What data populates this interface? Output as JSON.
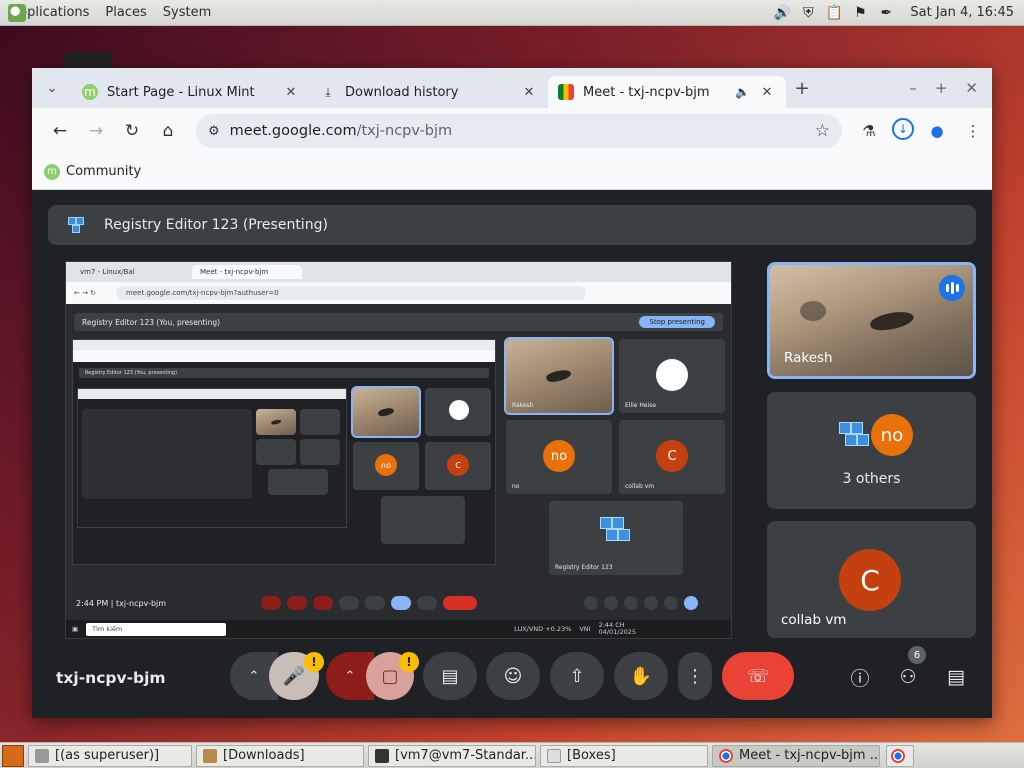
{
  "top_panel": {
    "menus": [
      "Applications",
      "Places",
      "System"
    ],
    "clock": "Sat Jan  4, 16:45",
    "tray_icons": [
      "volume-icon",
      "shield-icon",
      "clipboard-icon",
      "flag-icon",
      "pen-icon"
    ]
  },
  "browser": {
    "tabs": [
      {
        "title": "Start Page - Linux Mint",
        "icon": "mint-icon",
        "active": false
      },
      {
        "title": "Download history",
        "icon": "download-icon",
        "active": false
      },
      {
        "title": "Meet - txj-ncpv-bjm",
        "icon": "meet-icon",
        "active": true,
        "audio": true
      }
    ],
    "url_host": "meet.google.com",
    "url_path": "/txj-ncpv-bjm",
    "bookmarks": [
      "Community"
    ]
  },
  "meet": {
    "presenting_label": "Registry Editor 123 (Presenting)",
    "meeting_code": "txj-ncpv-bjm",
    "participants": [
      {
        "name": "Rakesh",
        "type": "video",
        "speaking": true
      },
      {
        "name": "3 others",
        "avatar_letters": "no"
      },
      {
        "name": "collab vm",
        "avatar_letter": "C",
        "avatar_color": "#c5400f"
      }
    ],
    "people_count": "6",
    "warning_glyph": "!",
    "shared_screen": {
      "tabs": [
        "vm7 - Linux/Bal",
        "Meet - txj-ncpv-bjm"
      ],
      "url": "meet.google.com/txj-ncpv-bjm?authuser=0",
      "presenting": "Registry Editor 123 (You, presenting)",
      "stop_label": "Stop presenting",
      "tiles": {
        "rakesh": "Rakesh",
        "ellie": "Ellie Heise",
        "no": "no",
        "no_avatar": "no",
        "collab": "collab vm",
        "collab_avatar": "C",
        "registry": "Registry Editor 123"
      },
      "nested_presenting": "Registry Editor 123 (You, presenting)",
      "time_code": "2:44 PM  |  txj-ncpv-bjm",
      "search": "Tìm kiếm",
      "tray_text": "LUX/VND  +0.23%",
      "lang": "VNI",
      "date": "2:44 CH\n04/01/2025"
    }
  },
  "taskbar": {
    "items": [
      {
        "label": "[(as superuser)]",
        "active": false
      },
      {
        "label": "[Downloads]",
        "active": false
      },
      {
        "label": "[vm7@vm7-Standar...",
        "active": false
      },
      {
        "label": "[Boxes]",
        "active": false
      },
      {
        "label": "Meet - txj-ncpv-bjm ...",
        "active": true
      }
    ]
  },
  "colors": {
    "meet_bg": "#202124",
    "tile_bg": "#3c4043",
    "hangup_red": "#ea4335",
    "accent_blue": "#8ab4f8",
    "avatar_orange": "#e8710a",
    "avatar_red": "#c5400f"
  }
}
